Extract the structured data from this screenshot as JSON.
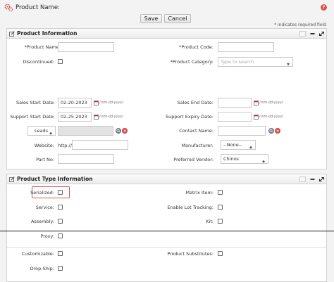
{
  "header": {
    "title": "Product Name:",
    "save_label": "Save",
    "cancel_label": "Cancel",
    "required_note": "* indicates required field"
  },
  "product_info": {
    "title": "Product Information",
    "product_name_label": "*Product Name:",
    "product_code_label": "*Product Code:",
    "discontinued_label": "Discontinued:",
    "category_label": "*Product Category:",
    "category_placeholder": "Type to search",
    "sales_start_label": "Sales Start Date:",
    "sales_start_value": "02-20-2023",
    "sales_end_label": "Sales End Date:",
    "support_start_label": "Support Start Date:",
    "support_start_value": "02-25-2023",
    "support_expiry_label": "Support Expiry Date:",
    "date_hint": "(mm-dd-yyyy)",
    "leads_value": "Leads",
    "contact_name_label": "Contact Name:",
    "website_label": "Website:",
    "website_prefix": "http://",
    "manufacturer_label": "Manufacturer:",
    "manufacturer_value": "--None--",
    "part_no_label": "Part No:",
    "preferred_vendor_label": "Preferred Vendor:",
    "preferred_vendor_value": "Chinos"
  },
  "product_type": {
    "title": "Product Type Information",
    "serialized_label": "Serialized:",
    "matrix_item_label": "Matrix Item:",
    "service_label": "Service:",
    "lot_tracking_label": "Enable Lot Tracking:",
    "assembly_label": "Assembly:",
    "kit_label": "Kit:",
    "proxy_label": "Proxy:",
    "customizable_label": "Customizable:",
    "substitutes_label": "Product Substitutes:",
    "drop_ship_label": "Drop-Ship:"
  },
  "colors": {
    "highlight_box": "#d9534f",
    "search_icon": "#6f7782",
    "clear_icon": "#d64545",
    "help_icon": "#d9534f",
    "gear_icon": "#d9534f"
  }
}
